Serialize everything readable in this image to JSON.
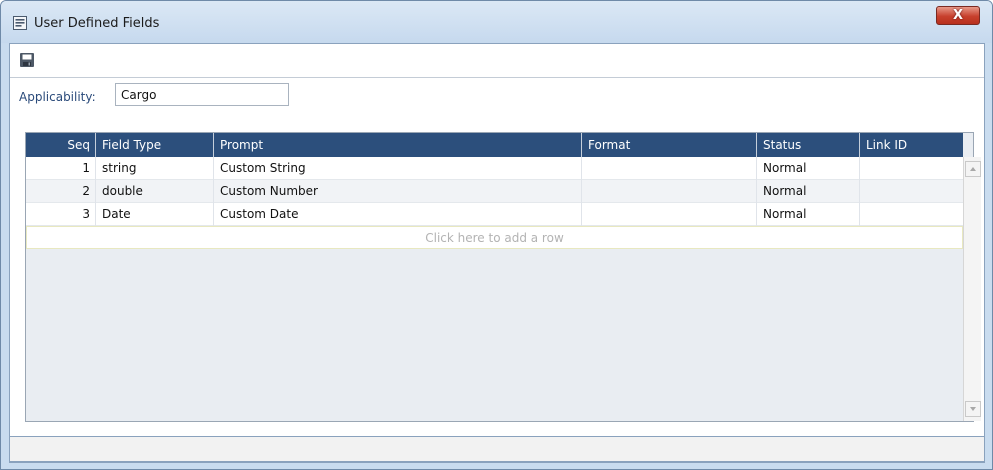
{
  "window": {
    "title": "User Defined Fields",
    "close_label": "X"
  },
  "form": {
    "applicability_label": "Applicability:",
    "applicability_value": "Cargo"
  },
  "grid": {
    "headers": [
      "Seq",
      "Field Type",
      "Prompt",
      "Format",
      "Status",
      "Link ID"
    ],
    "rows": [
      {
        "seq": "1",
        "field_type": "string",
        "prompt": "Custom String",
        "format": "",
        "status": "Normal",
        "link_id": ""
      },
      {
        "seq": "2",
        "field_type": "double",
        "prompt": "Custom Number",
        "format": "",
        "status": "Normal",
        "link_id": ""
      },
      {
        "seq": "3",
        "field_type": "Date",
        "prompt": "Custom Date",
        "format": "",
        "status": "Normal",
        "link_id": ""
      }
    ],
    "add_row_text": "Click here to add a row"
  },
  "colors": {
    "header_bg": "#2c4f7c",
    "title_bar": "#c9dcef",
    "close_button": "#c7402d"
  },
  "icons": {
    "window_icon": "form-icon",
    "toolbar_save": "save-icon",
    "scroll_up": "arrow-up-icon",
    "scroll_down": "arrow-down-icon"
  }
}
